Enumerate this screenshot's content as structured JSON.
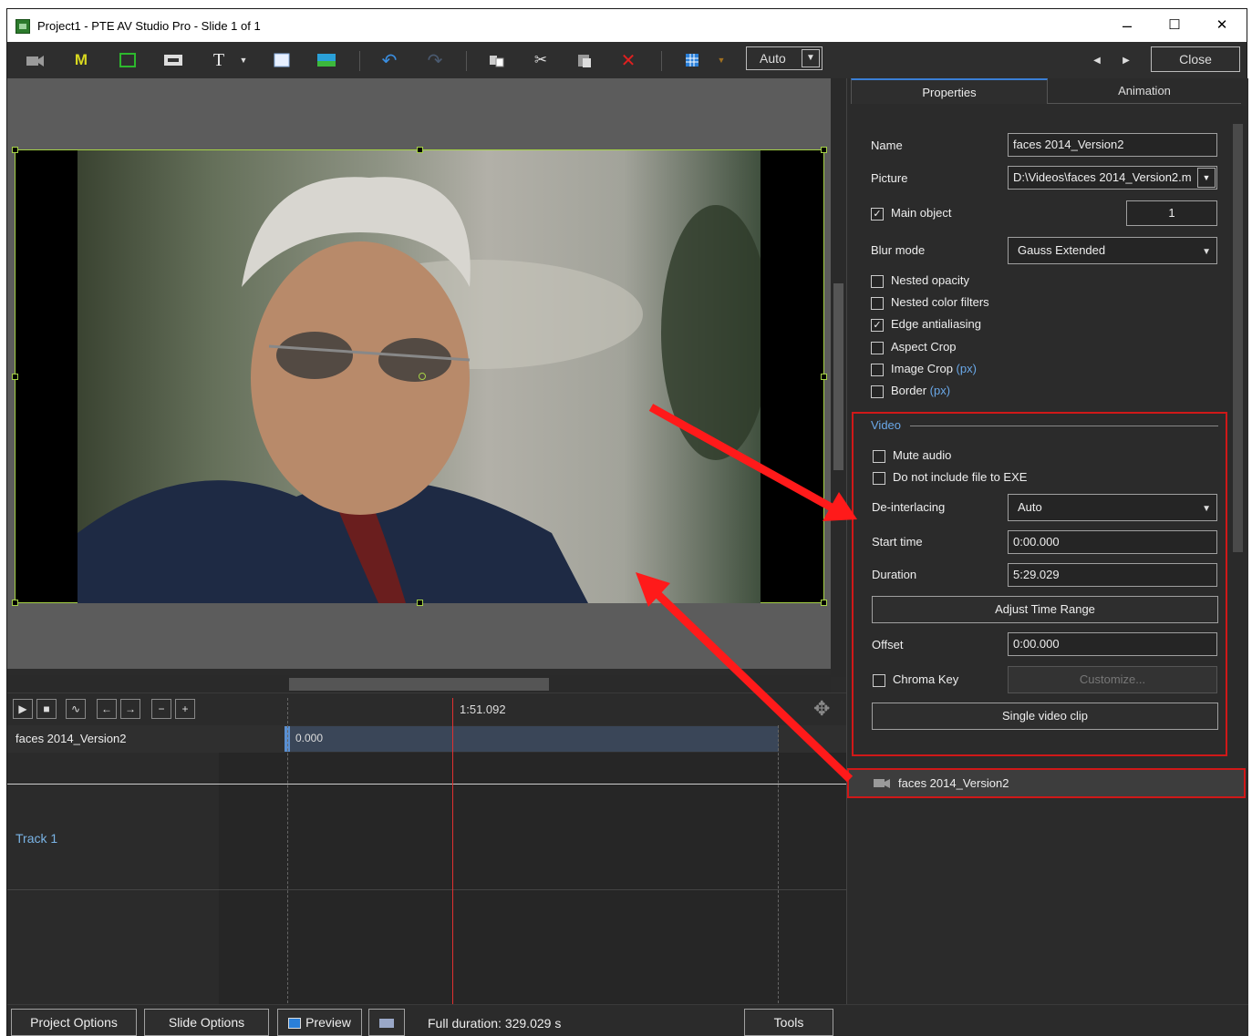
{
  "window": {
    "title": "Project1 - PTE AV Studio Pro - Slide 1 of 1",
    "minimize": "–",
    "maximize": "☐",
    "close": "✕"
  },
  "toolbar": {
    "zoom_value": "Auto",
    "close_label": "Close",
    "text_tool": "T",
    "m_tool": "M"
  },
  "timeline": {
    "current_time": "1:51.092",
    "object_name": "faces 2014_Version2",
    "object_start": "0.000",
    "track_label": "Track 1"
  },
  "panel": {
    "tabs": [
      "Properties",
      "Animation"
    ],
    "name_label": "Name",
    "name_value": "faces 2014_Version2",
    "picture_label": "Picture",
    "picture_value": "D:\\Videos\\faces 2014_Version2.m",
    "main_object_label": "Main object",
    "main_object_value": "1",
    "blur_label": "Blur mode",
    "blur_value": "Gauss Extended",
    "nested_opacity": "Nested opacity",
    "nested_color": "Nested color filters",
    "edge_aa": "Edge antialiasing",
    "aspect_crop": "Aspect Crop",
    "image_crop": "Image Crop",
    "border": "Border",
    "px_unit": "(px)",
    "video_section": "Video",
    "mute_audio": "Mute audio",
    "no_exe": "Do not include file to EXE",
    "deint_label": "De-interlacing",
    "deint_value": "Auto",
    "start_label": "Start time",
    "start_value": "0:00.000",
    "duration_label": "Duration",
    "duration_value": "5:29.029",
    "adjust_btn": "Adjust Time Range",
    "offset_label": "Offset",
    "offset_value": "0:00.000",
    "chroma_label": "Chroma Key",
    "customize_btn": "Customize...",
    "single_clip_btn": "Single video clip",
    "list_item": "faces 2014_Version2"
  },
  "bottom": {
    "project_options": "Project Options",
    "slide_options": "Slide Options",
    "preview": "Preview",
    "full_duration": "Full duration: 329.029 s",
    "tools": "Tools"
  },
  "colors": {
    "selection": "#a6d246",
    "highlight_box": "#d01818",
    "arrow": "#ff1a1a",
    "playhead": "#e03030"
  }
}
